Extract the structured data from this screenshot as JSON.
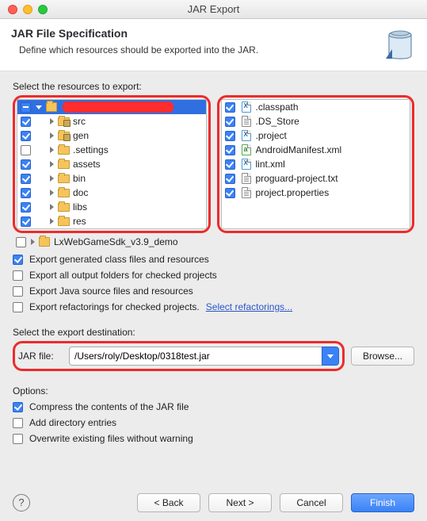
{
  "window": {
    "title": "JAR Export"
  },
  "header": {
    "title": "JAR File Specification",
    "subtitle": "Define which resources should be exported into the JAR."
  },
  "resources_label": "Select the resources to export:",
  "left_tree": {
    "root": {
      "label": ""
    },
    "items": [
      {
        "label": "src",
        "checked": true
      },
      {
        "label": "gen",
        "checked": true
      },
      {
        "label": ".settings",
        "checked": false
      },
      {
        "label": "assets",
        "checked": true
      },
      {
        "label": "bin",
        "checked": true
      },
      {
        "label": "doc",
        "checked": true
      },
      {
        "label": "libs",
        "checked": true
      },
      {
        "label": "res",
        "checked": true
      }
    ],
    "extra": {
      "label": "LxWebGameSdk_v3.9_demo",
      "checked": false
    }
  },
  "right_list": [
    {
      "label": ".classpath",
      "checked": true,
      "icon": "x"
    },
    {
      "label": ".DS_Store",
      "checked": true,
      "icon": "t"
    },
    {
      "label": ".project",
      "checked": true,
      "icon": "x"
    },
    {
      "label": "AndroidManifest.xml",
      "checked": true,
      "icon": "m"
    },
    {
      "label": "lint.xml",
      "checked": true,
      "icon": "x"
    },
    {
      "label": "proguard-project.txt",
      "checked": true,
      "icon": "t"
    },
    {
      "label": "project.properties",
      "checked": true,
      "icon": "t"
    }
  ],
  "export_options": {
    "o1": {
      "label": "Export generated class files and resources",
      "checked": true
    },
    "o2": {
      "label": "Export all output folders for checked projects",
      "checked": false
    },
    "o3": {
      "label": "Export Java source files and resources",
      "checked": false
    },
    "o4": {
      "label": "Export refactorings for checked projects.",
      "checked": false
    },
    "refactor_link": "Select refactorings..."
  },
  "destination": {
    "label": "Select the export destination:",
    "field_label": "JAR file:",
    "path": "/Users/roly/Desktop/0318test.jar",
    "browse": "Browse..."
  },
  "options": {
    "heading": "Options:",
    "c1": {
      "label": "Compress the contents of the JAR file",
      "checked": true
    },
    "c2": {
      "label": "Add directory entries",
      "checked": false
    },
    "c3": {
      "label": "Overwrite existing files without warning",
      "checked": false
    }
  },
  "footer": {
    "help": "?",
    "back": "< Back",
    "next": "Next >",
    "cancel": "Cancel",
    "finish": "Finish"
  }
}
